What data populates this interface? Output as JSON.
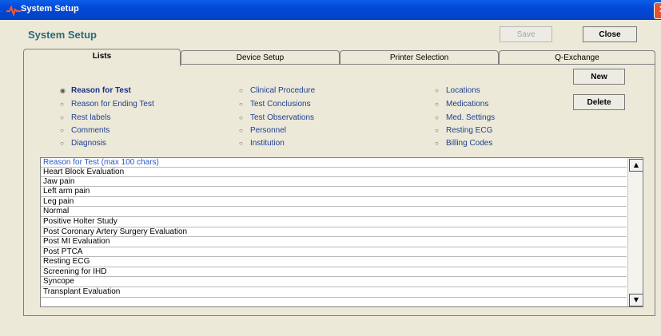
{
  "window": {
    "title": "System Setup",
    "accent": "#0349d8"
  },
  "header": {
    "title": "System Setup"
  },
  "toolbar": {
    "save_label": "Save",
    "close_label": "Close"
  },
  "tabs": [
    {
      "label": "Lists",
      "active": true
    },
    {
      "label": "Device Setup",
      "active": false
    },
    {
      "label": "Printer Selection",
      "active": false
    },
    {
      "label": "Q-Exchange",
      "active": false
    }
  ],
  "radios": {
    "col1": [
      "Reason for Test",
      "Reason for Ending Test",
      "Rest labels",
      "Comments",
      "Diagnosis"
    ],
    "col2": [
      "Clinical Procedure",
      "Test Conclusions",
      "Test Observations",
      "Personnel",
      "Institution"
    ],
    "col3": [
      "Locations",
      "Medications",
      "Med. Settings",
      "Resting ECG",
      "Billing Codes"
    ],
    "selected": "Reason for Test"
  },
  "side_buttons": {
    "new_label": "New",
    "delete_label": "Delete"
  },
  "list": {
    "header": "Reason for Test (max 100 chars)",
    "items": [
      "Heart Block Evaluation",
      "Jaw pain",
      "Left arm pain",
      "Leg pain",
      "Normal",
      "Positive Holter Study",
      "Post Coronary Artery Surgery Evaluation",
      "Post MI Evaluation",
      "Post PTCA",
      "Resting ECG",
      "Screening for IHD",
      "Syncope",
      "Transplant Evaluation"
    ]
  }
}
